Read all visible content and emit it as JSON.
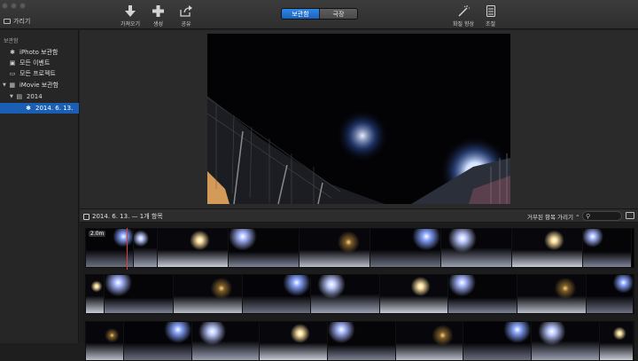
{
  "toolbar": {
    "library_toggle_label": "가리기",
    "import_label": "가져오기",
    "create_label": "생성",
    "share_label": "공유",
    "library_tab_label": "보관함",
    "theater_tab_label": "극장",
    "enhance_label": "화질 향상",
    "adjust_label": "조절"
  },
  "sidebar": {
    "header": "보관함",
    "items": [
      {
        "label": "iPhoto 보관함",
        "icon": "star-icon"
      },
      {
        "label": "모든 이벤트",
        "icon": "film-icon"
      },
      {
        "label": "모든 프로젝트",
        "icon": "project-icon"
      },
      {
        "label": "iMovie 보관함",
        "icon": "grid-icon"
      },
      {
        "label": "2014",
        "icon": "folder-icon"
      },
      {
        "label": "2014. 6. 13.",
        "icon": "star-icon"
      }
    ],
    "selected": "2014. 6. 13."
  },
  "browser": {
    "event_title": "2014. 6. 13. — 1개 항목",
    "filter_label": "거부된 항목 가리기",
    "clip_duration": "2.0m"
  },
  "colors": {
    "accent": "#1b5fb4",
    "selected_tab": "#2f86e6",
    "playhead": "#e04030"
  }
}
